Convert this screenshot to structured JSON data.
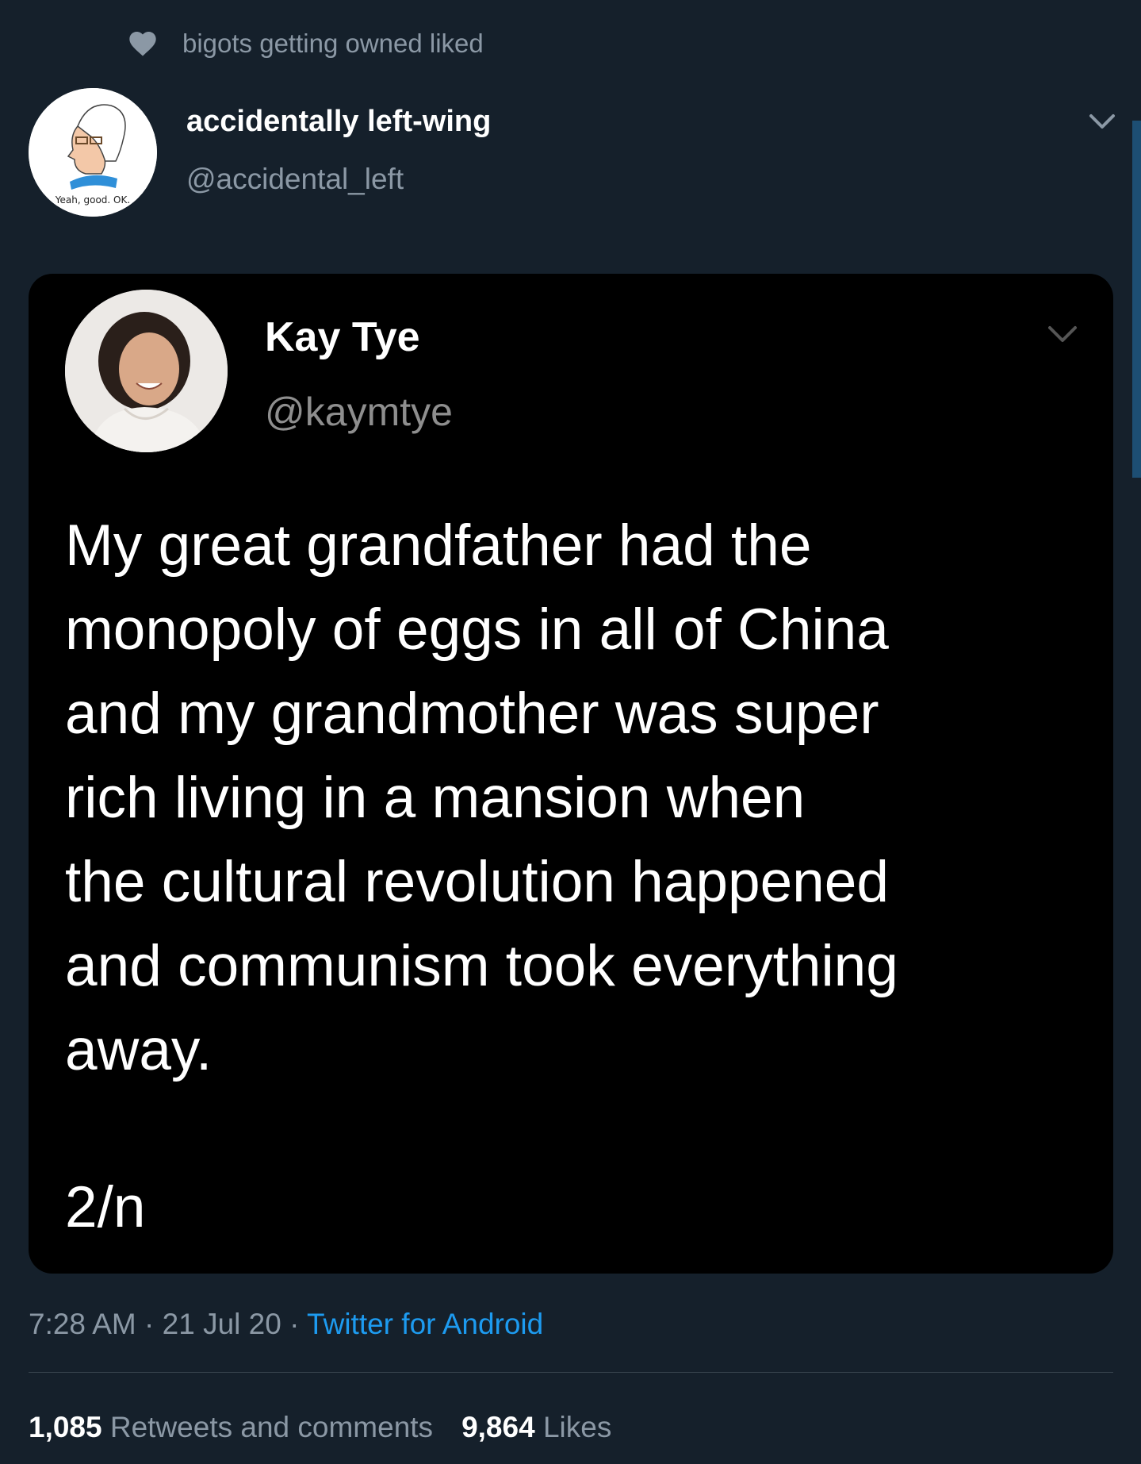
{
  "social_context": {
    "text": "bigots getting owned liked"
  },
  "tweet": {
    "author": {
      "name": "accidentally left-wing",
      "handle": "@accidental_left",
      "avatar_caption": "Yeah, good. OK."
    },
    "embedded": {
      "author": {
        "name": "Kay Tye",
        "handle": "@kaymtye"
      },
      "text": "My great grandfather had the\nmonopoly of eggs in all of China\nand my grandmother was super\nrich living in a mansion when\nthe cultural revolution happened\nand communism took everything\naway.",
      "counter": "2/n"
    },
    "meta": {
      "time": "7:28 AM",
      "separator": " · ",
      "date": "21 Jul 20",
      "source": "Twitter for Android"
    },
    "stats": {
      "retweets_count": "1,085",
      "retweets_label": "Retweets and comments",
      "likes_count": "9,864",
      "likes_label": "Likes"
    }
  },
  "colors": {
    "background": "#15202b",
    "secondary_text": "#8b98a5",
    "link": "#1d9bf0",
    "embed_background": "#000000"
  },
  "icons": [
    "heart-icon",
    "chevron-down-icon"
  ]
}
